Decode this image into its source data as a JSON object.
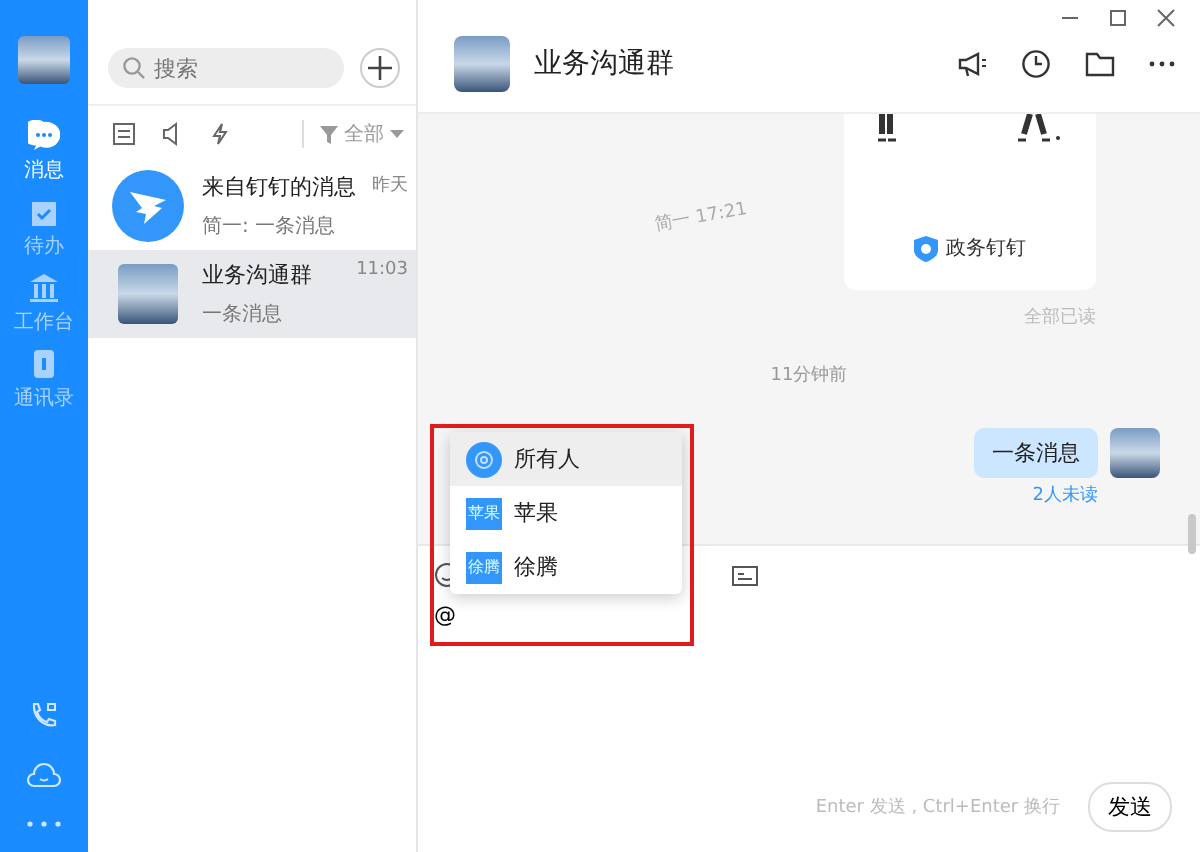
{
  "sidebar": {
    "nav": [
      {
        "kind": "chat",
        "label": "消息",
        "selected": true
      },
      {
        "kind": "todo",
        "label": "待办",
        "selected": false
      },
      {
        "kind": "bank",
        "label": "工作台",
        "selected": false
      },
      {
        "kind": "book",
        "label": "通讯录",
        "selected": false
      }
    ]
  },
  "conversations": {
    "search": {
      "placeholder": "搜索"
    },
    "filter": "全部",
    "items": [
      {
        "kind": "logo",
        "name": "来自钉钉的消息",
        "preview": "简一: 一条消息",
        "time": "昨天",
        "selected": false
      },
      {
        "kind": "photo",
        "name": "业务沟通群",
        "preview": "一条消息",
        "time": "11:03",
        "selected": true
      }
    ]
  },
  "chat": {
    "title": "业务沟通群",
    "card_brand": "政务钉钉",
    "read_status": "全部已读",
    "watermark": "简一 17:21",
    "time_divider": "11分钟前",
    "message": {
      "text": "一条消息",
      "unread": "2人未读"
    },
    "mention_popup": [
      {
        "kind": "all",
        "name": "所有人",
        "selected": true
      },
      {
        "kind": "text",
        "avatar": "苹果",
        "name": "苹果",
        "selected": false
      },
      {
        "kind": "text",
        "avatar": "徐腾",
        "name": "徐腾",
        "selected": false
      }
    ],
    "input": {
      "value": "@"
    },
    "hint": "Enter 发送 , Ctrl+Enter 换行",
    "send_button": "发送"
  }
}
